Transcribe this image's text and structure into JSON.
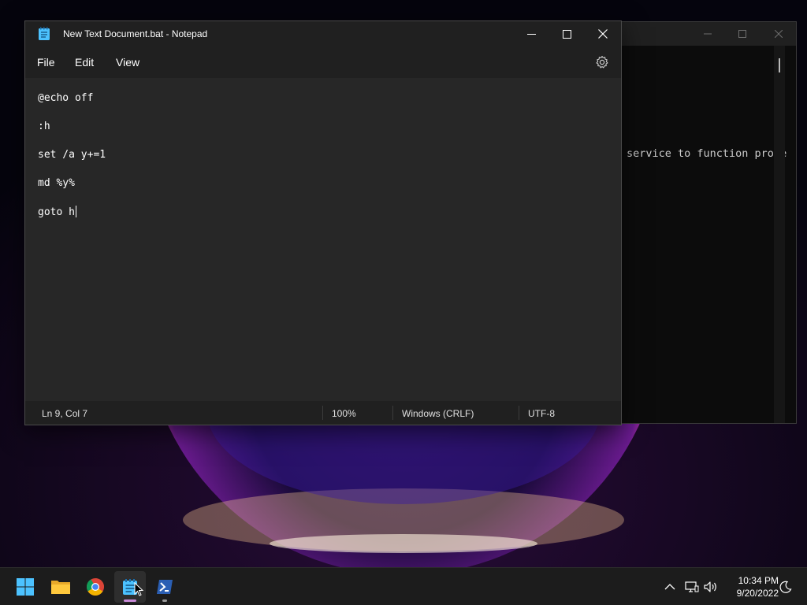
{
  "notepad": {
    "title": "New Text Document.bat - Notepad",
    "menu": [
      "File",
      "Edit",
      "View"
    ],
    "lines": [
      "@echo off",
      ":h",
      "set /a y+=1",
      "md %y%",
      "goto h"
    ],
    "status": {
      "position": "Ln 9, Col 7",
      "zoom": "100%",
      "line_ending": "Windows (CRLF)",
      "encoding": "UTF-8"
    }
  },
  "console": {
    "visible_text": "service to function prope"
  },
  "taskbar": {
    "apps": [
      "start-icon",
      "file-explorer-icon",
      "chrome-icon",
      "notepad-icon",
      "powershell-icon"
    ],
    "tray_icons": [
      "chevron-up-icon",
      "network-icon",
      "volume-icon",
      "focus-assist-icon"
    ],
    "time": "10:34 PM",
    "date": "9/20/2022"
  },
  "colors": {
    "accent": "#60cdff",
    "notepad_icon": "#4cc2ff",
    "powershell": "#2b5fb4"
  }
}
